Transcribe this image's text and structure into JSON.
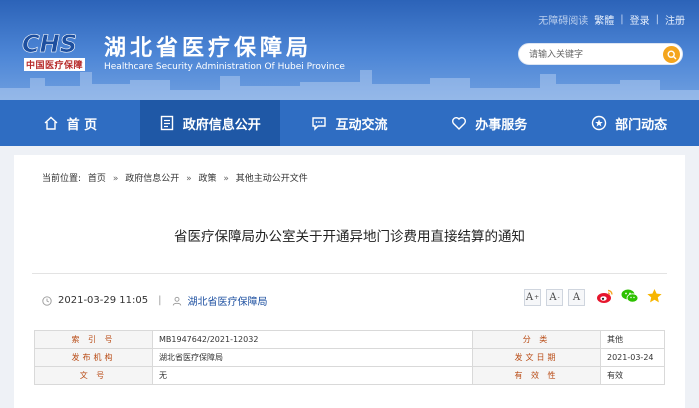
{
  "header": {
    "logo_mark": "CHS",
    "logo_cn": "中国医疗保障",
    "title": "湖北省医疗保障局",
    "subtitle": "Healthcare Security Administration Of Hubei Province",
    "toplinks": {
      "accessibility": "无障碍阅读",
      "traditional": "繁體",
      "login": "登录",
      "register": "注册",
      "sep": "|"
    },
    "search": {
      "placeholder": "请输入关键字",
      "icon": "search-icon",
      "button_color": "#f4a51d"
    }
  },
  "nav": {
    "items": [
      {
        "label": "首 页",
        "icon": "home-icon"
      },
      {
        "label": "政府信息公开",
        "icon": "document-icon",
        "active": true
      },
      {
        "label": "互动交流",
        "icon": "chat-icon"
      },
      {
        "label": "办事服务",
        "icon": "heart-icon"
      },
      {
        "label": "部门动态",
        "icon": "star-circle-icon"
      }
    ],
    "color": "#2f6dc2",
    "active_color": "#1f58a6"
  },
  "breadcrumb": {
    "prefix": "当前位置:",
    "items": [
      "首页",
      "政府信息公开",
      "政策",
      "其他主动公开文件"
    ],
    "sep": "»"
  },
  "document": {
    "title": "省医疗保障局办公室关于开通异地门诊费用直接结算的通知",
    "datetime": "2021-03-29 11:05",
    "meta_sep": "|",
    "source": "湖北省医疗保障局",
    "font_buttons": [
      "A",
      "A",
      "A"
    ],
    "font_button_sups": [
      "+",
      "-",
      ""
    ],
    "share_icons": [
      "weibo-icon",
      "wechat-icon",
      "favorite-star-icon"
    ]
  },
  "info_table": {
    "rows": [
      {
        "label1": "索 引 号",
        "value1": "MB1947642/2021-12032",
        "label2": "分 类",
        "value2": "其他"
      },
      {
        "label1": "发布机构",
        "value1": "湖北省医疗保障局",
        "label2": "发文日期",
        "value2": "2021-03-24"
      },
      {
        "label1": "文 号",
        "value1": "无",
        "label2": "有 效 性",
        "value2": "有效"
      }
    ]
  }
}
